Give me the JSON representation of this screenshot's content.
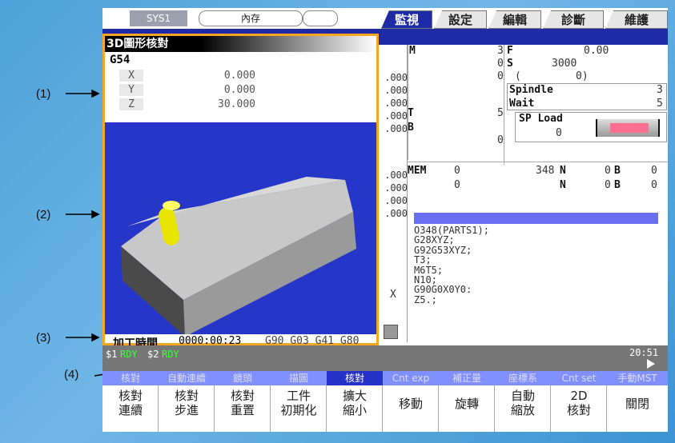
{
  "top": {
    "sys_label": "SYS1",
    "memory_label": "內存"
  },
  "tabs": [
    {
      "label": "監視"
    },
    {
      "label": "設定"
    },
    {
      "label": "編輯"
    },
    {
      "label": "診斷"
    },
    {
      "label": "維護"
    }
  ],
  "sim": {
    "title": "3D圖形核對",
    "coord_system": "G54",
    "axes": [
      {
        "name": "X",
        "value": "0.000"
      },
      {
        "name": "Y",
        "value": "0.000"
      },
      {
        "name": "Z",
        "value": "30.000"
      }
    ],
    "time_label": "加工時間",
    "time_value": "0000:00:23",
    "gcodes": "G90 G03 G41 G80"
  },
  "mid_values": [
    ".000",
    ".000",
    ".000",
    ".000",
    ".000",
    ".000",
    ".000",
    ".000",
    ".000",
    ".000"
  ],
  "side": {
    "x_label": "X"
  },
  "right": {
    "m_label": "M",
    "m_value": "3",
    "f_label": "F",
    "f_value": "0.00",
    "s_label": "S",
    "s_value": "3000",
    "paren_open": "(",
    "paren_value": "0)",
    "t_label": "T",
    "t_value": "5",
    "b_label": "B",
    "b_value": "0",
    "mrow1": "0",
    "mrow2": "0",
    "spindle_label": "Spindle",
    "spindle_value": "3",
    "wait_label": "Wait",
    "wait_value": "5",
    "spload_label": "SP Load",
    "spload_value": "0",
    "mem_label": "MEM",
    "mem_row1": {
      "c1": "0",
      "c2": "348",
      "n": "N",
      "nv": "0",
      "b": "B",
      "bv": "0"
    },
    "mem_row2": {
      "c1": "0",
      "n": "N",
      "nv": "0",
      "b": "B",
      "bv": "0"
    },
    "program_lines": [
      "O348(PARTS1);",
      "G28XYZ;",
      "G92G53XYZ;",
      "T3;",
      "M6T5;",
      "N10;",
      "G90G0X0Y0:",
      "Z5.;"
    ]
  },
  "status": {
    "s1": "$1",
    "rdy1": "RDY",
    "s2": "$2",
    "rdy2": "RDY",
    "clock": "20:51"
  },
  "softkeys": [
    {
      "top": "核對",
      "bottom": "核對\n連續"
    },
    {
      "top": "自動連續",
      "bottom": "核對\n步進"
    },
    {
      "top": "鏡頭",
      "bottom": "核對\n重置"
    },
    {
      "top": "描圖",
      "bottom": "工件\n初期化"
    },
    {
      "top": "核對",
      "bottom": "擴大\n縮小"
    },
    {
      "top": "Cnt exp",
      "bottom": "移動"
    },
    {
      "top": "補正量",
      "bottom": "旋轉"
    },
    {
      "top": "座標系",
      "bottom": "自動\n縮放"
    },
    {
      "top": "Cnt set",
      "bottom": "2D\n核對"
    },
    {
      "top": "手動MST",
      "bottom": "關閉"
    }
  ],
  "callouts": [
    "(1)",
    "(2)",
    "(3)",
    "(4)"
  ],
  "colors": {
    "frame_highlight": "#f5a623",
    "tab_active": "#1f2aa6",
    "ready": "#3cff3c",
    "view_bg": "#2636c9"
  }
}
